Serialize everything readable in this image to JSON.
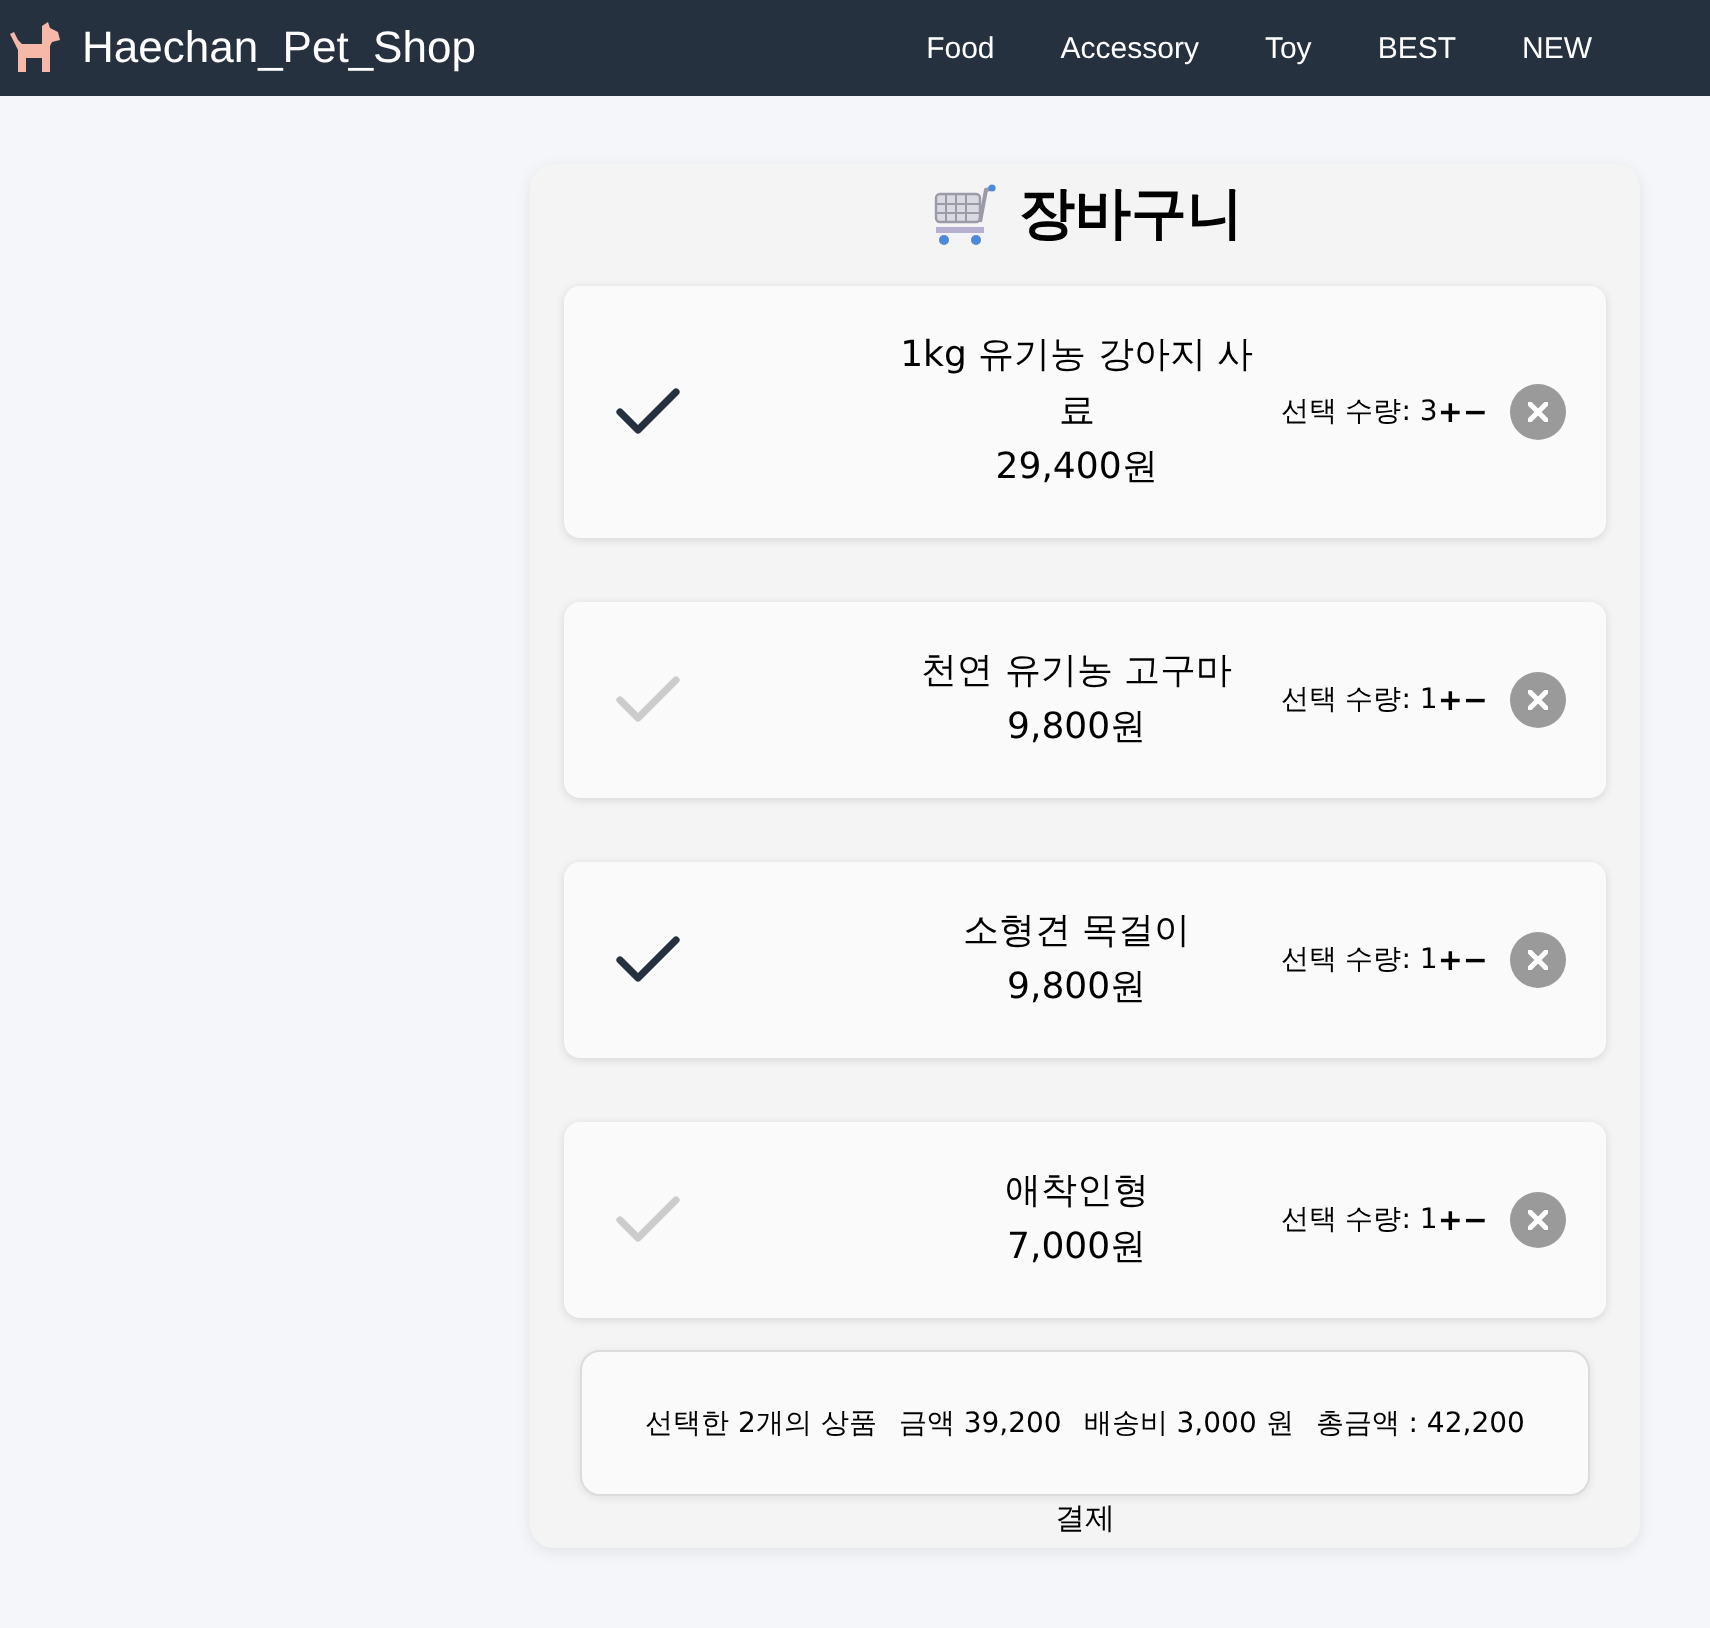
{
  "header": {
    "logo_text": "Haechan_Pet_Shop",
    "nav": [
      "Food",
      "Accessory",
      "Toy",
      "BEST",
      "NEW"
    ]
  },
  "cart": {
    "title": "장바구니",
    "items": [
      {
        "name": "1kg 유기농 강아지 사료",
        "price": "29,400원",
        "selected": true,
        "quantity_label": "선택 수량:",
        "quantity": "3",
        "increase": "+",
        "decrease": "−"
      },
      {
        "name": "천연 유기농 고구마",
        "price": "9,800원",
        "selected": false,
        "quantity_label": "선택 수량:",
        "quantity": "1",
        "increase": "+",
        "decrease": "−"
      },
      {
        "name": "소형견 목걸이",
        "price": "9,800원",
        "selected": true,
        "quantity_label": "선택 수량:",
        "quantity": "1",
        "increase": "+",
        "decrease": "−"
      },
      {
        "name": "애착인형",
        "price": "7,000원",
        "selected": false,
        "quantity_label": "선택 수량:",
        "quantity": "1",
        "increase": "+",
        "decrease": "−"
      }
    ]
  },
  "summary": {
    "selected_count": "선택한 2개의 상품",
    "amount": "금액 39,200",
    "shipping": "배송비 3,000 원",
    "total": "총금액 : 42,200"
  },
  "pay_button": "결제"
}
